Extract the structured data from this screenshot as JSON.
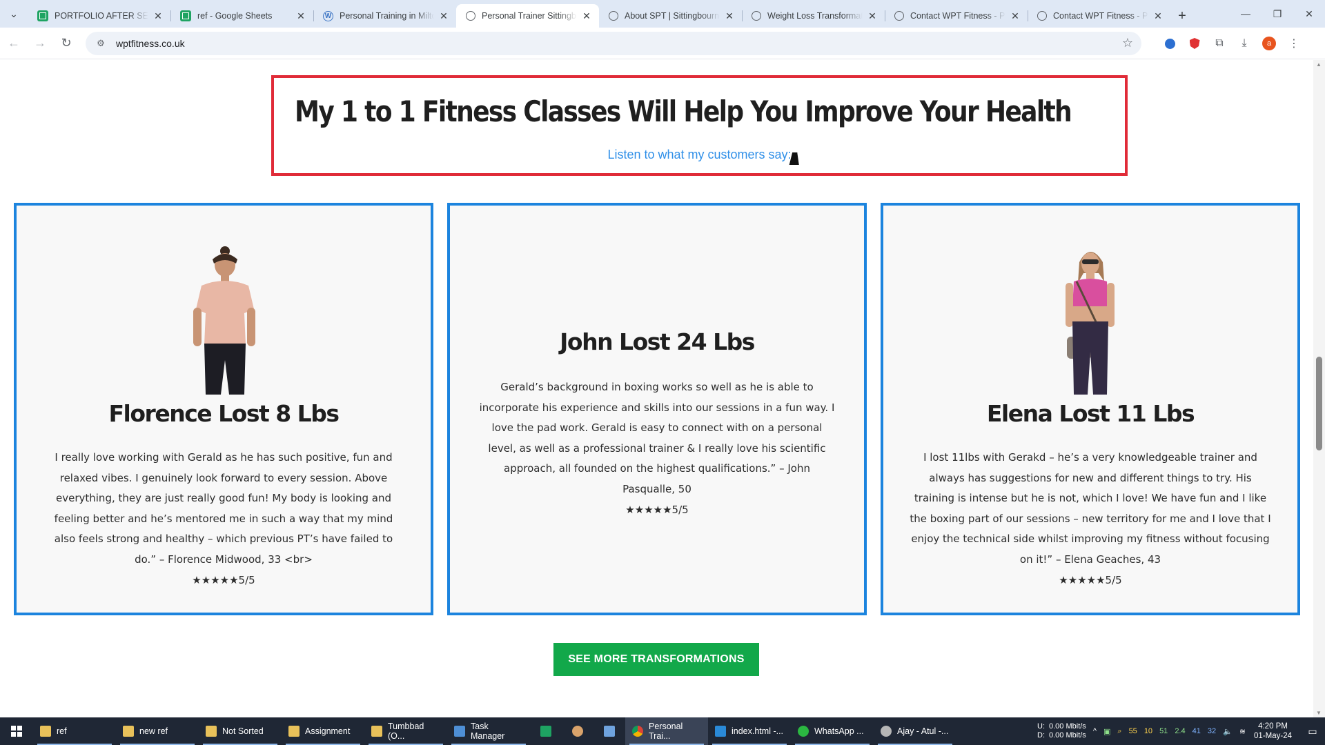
{
  "browser": {
    "tabs": [
      {
        "title": "PORTFOLIO AFTER SELLING",
        "icon": "sheets-icon",
        "active": false
      },
      {
        "title": "ref - Google Sheets",
        "icon": "sheets-icon",
        "active": false
      },
      {
        "title": "Personal Training in Milton",
        "icon": "wordpress-icon",
        "active": false
      },
      {
        "title": "Personal Trainer Sittingbourne",
        "icon": "globe-icon",
        "active": true
      },
      {
        "title": "About SPT | Sittingbourne",
        "icon": "globe-icon",
        "active": false
      },
      {
        "title": "Weight Loss Transformations",
        "icon": "globe-icon",
        "active": false
      },
      {
        "title": "Contact WPT Fitness - Personal",
        "icon": "globe-icon",
        "active": false
      },
      {
        "title": "Contact WPT Fitness - Personal",
        "icon": "globe-icon",
        "active": false
      }
    ],
    "url": "wptfitness.co.uk"
  },
  "page": {
    "headline": "My 1 to 1 Fitness Classes Will Help You Improve Your Health",
    "subheadline": "Listen to what my customers say:",
    "testimonials": [
      {
        "title": "Florence Lost 8 Lbs",
        "text": "I really love working with Gerald as he has such positive, fun and relaxed vibes. I genuinely look forward to every session. Above everything, they are just really good fun! My body is looking and feeling better and he’s mentored me in such a way that my mind also feels strong and healthy – which previous PT’s have failed to do.” – Florence Midwood, 33 <br>",
        "rating": "★★★★★5/5"
      },
      {
        "title": "John Lost 24 Lbs",
        "text": "Gerald’s background in boxing works so well as he is able to incorporate his experience and skills into our sessions in a fun way. I love the pad work. Gerald is easy to connect with on a personal level, as well as a professional trainer & I really love his scientific approach, all founded on the highest qualifications.” – John Pasqualle, 50",
        "rating": "★★★★★5/5"
      },
      {
        "title": "Elena Lost 11 Lbs",
        "text": "I lost 11lbs with Gerakd – he’s a very knowledgeable trainer and always has suggestions for new and different things to try. His training is intense but he is not, which I love! We have fun and I like the boxing part of our sessions – new territory for me and I love that I enjoy the technical side whilst improving my fitness without focusing on it!” – Elena Geaches, 43",
        "rating": "★★★★★5/5"
      }
    ],
    "cta_label": "SEE MORE TRANSFORMATIONS"
  },
  "taskbar": {
    "items": [
      {
        "label": "ref",
        "icon": "folder-icon"
      },
      {
        "label": "new ref",
        "icon": "folder-icon"
      },
      {
        "label": "Not Sorted",
        "icon": "folder-icon"
      },
      {
        "label": "Assignment",
        "icon": "folder-icon"
      },
      {
        "label": "Tumbbad (O...",
        "icon": "folder-icon"
      },
      {
        "label": "Task Manager",
        "icon": "task-manager-icon"
      },
      {
        "label": "Personal Trai...",
        "icon": "chrome-icon"
      },
      {
        "label": "index.html -...",
        "icon": "vscode-icon"
      },
      {
        "label": "WhatsApp ...",
        "icon": "whatsapp-icon"
      },
      {
        "label": "Ajay - Atul -...",
        "icon": "media-icon"
      }
    ],
    "net_upload_label": "U:",
    "net_download_label": "D:",
    "net_upload": "0.00 Mbit/s",
    "net_download": "0.00 Mbit/s",
    "tray_values": [
      "55",
      "10",
      "51",
      "2.4",
      "41",
      "32"
    ],
    "time": "4:20 PM",
    "date": "01-May-24"
  },
  "colors": {
    "headline_border": "#e02b38",
    "card_border": "#1c84de",
    "subheadline": "#2f8fe8",
    "cta_background": "#12a84a"
  }
}
